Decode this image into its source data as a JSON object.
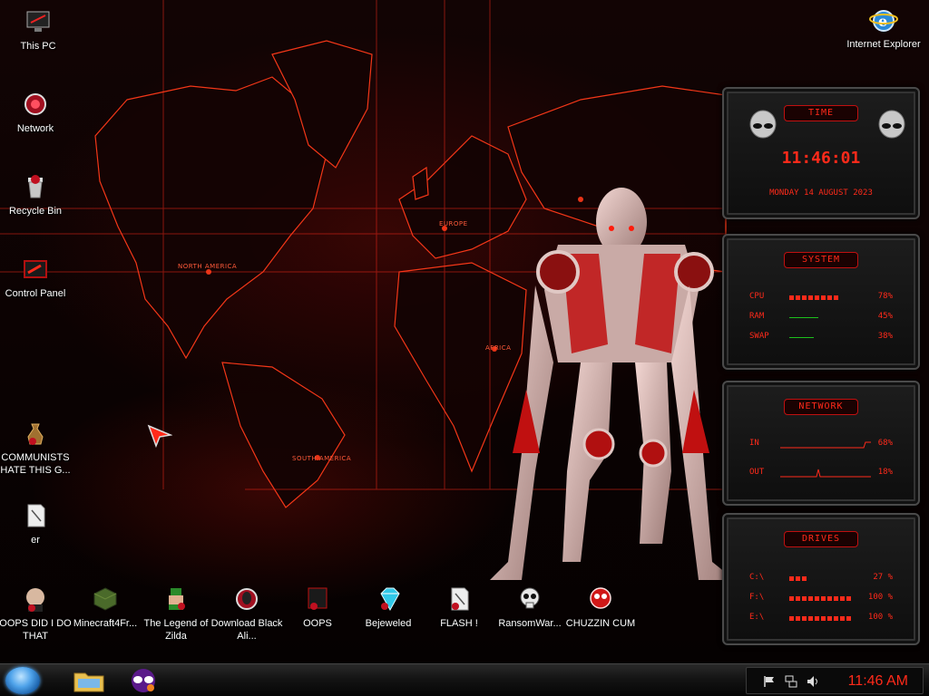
{
  "desktop_icons": [
    {
      "label": "This PC",
      "icon": "monitor-icon"
    },
    {
      "label": "Network",
      "icon": "network-icon"
    },
    {
      "label": "Recycle Bin",
      "icon": "recycle-bin-icon"
    },
    {
      "label": "Control Panel",
      "icon": "control-panel-icon"
    },
    {
      "label": "COMMUNISTS HATE THIS G...",
      "icon": "money-bag-icon"
    },
    {
      "label": "er",
      "icon": "file-icon"
    },
    {
      "label": "Internet Explorer",
      "icon": "internet-explorer-icon"
    },
    {
      "label": "OOPS DID I DO THAT",
      "icon": "app-icon"
    },
    {
      "label": "Minecraft4Fr...",
      "icon": "minecraft-icon"
    },
    {
      "label": "The Legend of Zilda",
      "icon": "game-icon"
    },
    {
      "label": "Download Black Ali...",
      "icon": "alien-icon"
    },
    {
      "label": "OOPS",
      "icon": "app-icon"
    },
    {
      "label": "Bejeweled",
      "icon": "gem-icon"
    },
    {
      "label": "FLASH !",
      "icon": "file-icon"
    },
    {
      "label": "RansomWar...",
      "icon": "skull-icon"
    },
    {
      "label": "CHUZZIN CUM",
      "icon": "app-icon"
    }
  ],
  "map_labels": {
    "north_america": "NORTH AMERICA",
    "europe": "EUROPE",
    "africa": "AFRICA",
    "south_america": "SOUTH AMERICA"
  },
  "widgets": {
    "time": {
      "title": "TIME",
      "clock": "11:46:01",
      "date": "MONDAY 14 AUGUST 2023"
    },
    "system": {
      "title": "SYSTEM",
      "rows": [
        {
          "label": "CPU",
          "value": "78%",
          "fraction": 0.78
        },
        {
          "label": "RAM",
          "value": "45%",
          "fraction": 0.45
        },
        {
          "label": "SWAP",
          "value": "38%",
          "fraction": 0.38
        }
      ]
    },
    "network": {
      "title": "NETWORK",
      "rows": [
        {
          "label": "IN",
          "value": "68%"
        },
        {
          "label": "OUT",
          "value": "18%"
        }
      ]
    },
    "drives": {
      "title": "DRIVES",
      "rows": [
        {
          "label": "C:\\",
          "value": "27 %",
          "fraction": 0.27
        },
        {
          "label": "F:\\",
          "value": "100 %",
          "fraction": 1.0
        },
        {
          "label": "E:\\",
          "value": "100 %",
          "fraction": 1.0
        }
      ]
    }
  },
  "taskbar": {
    "clock": "11:46 AM"
  },
  "colors": {
    "accent": "#ff2a1a",
    "widget_bg": "#111111",
    "taskbar": "#141414"
  }
}
